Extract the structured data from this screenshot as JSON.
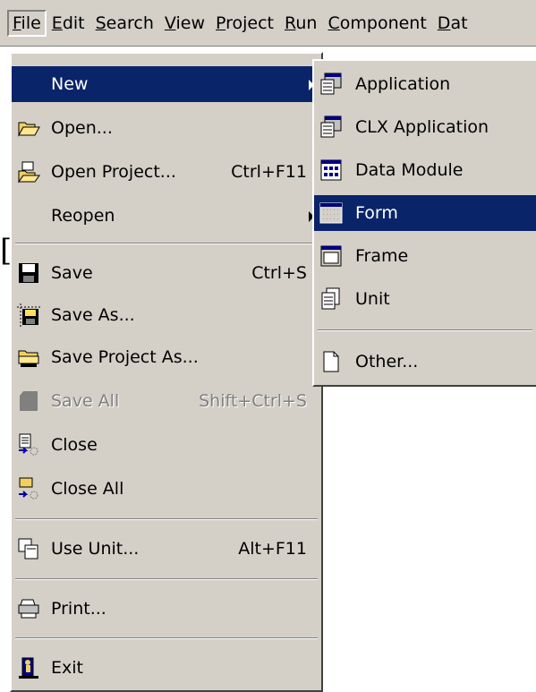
{
  "menubar": {
    "items": [
      {
        "label": "File",
        "accel": "F",
        "rest": "ile"
      },
      {
        "label": "Edit",
        "accel": "E",
        "rest": "dit"
      },
      {
        "label": "Search",
        "accel": "S",
        "rest": "earch"
      },
      {
        "label": "View",
        "accel": "V",
        "rest": "iew"
      },
      {
        "label": "Project",
        "accel": "P",
        "rest": "roject"
      },
      {
        "label": "Run",
        "accel": "R",
        "rest": "un"
      },
      {
        "label": "Component",
        "accel": "C",
        "rest": "omponent"
      },
      {
        "label": "Dat",
        "accel": "D",
        "rest": "at"
      }
    ]
  },
  "file_menu": {
    "items": [
      {
        "label": "New",
        "shortcut": "",
        "icon": "none",
        "submenu": true,
        "selected": true
      },
      {
        "label": "Open...",
        "shortcut": "",
        "icon": "open-folder-icon"
      },
      {
        "label": "Open Project...",
        "shortcut": "Ctrl+F11",
        "icon": "open-project-icon"
      },
      {
        "label": "Reopen",
        "shortcut": "",
        "icon": "none",
        "submenu": true
      },
      {
        "label": "Save",
        "shortcut": "Ctrl+S",
        "icon": "floppy-icon"
      },
      {
        "label": "Save As...",
        "shortcut": "",
        "icon": "save-as-icon"
      },
      {
        "label": "Save Project As...",
        "shortcut": "",
        "icon": "save-project-icon"
      },
      {
        "label": "Save All",
        "shortcut": "Shift+Ctrl+S",
        "icon": "save-all-icon",
        "disabled": true
      },
      {
        "label": "Close",
        "shortcut": "",
        "icon": "close-file-icon"
      },
      {
        "label": "Close All",
        "shortcut": "",
        "icon": "close-all-icon"
      },
      {
        "label": "Use Unit...",
        "shortcut": "Alt+F11",
        "icon": "use-unit-icon"
      },
      {
        "label": "Print...",
        "shortcut": "",
        "icon": "printer-icon"
      },
      {
        "label": "Exit",
        "shortcut": "",
        "icon": "exit-door-icon"
      }
    ]
  },
  "new_menu": {
    "items": [
      {
        "label": "Application",
        "icon": "application-icon"
      },
      {
        "label": "CLX Application",
        "icon": "clx-application-icon"
      },
      {
        "label": "Data Module",
        "icon": "data-module-icon"
      },
      {
        "label": "Form",
        "icon": "form-icon",
        "selected": true
      },
      {
        "label": "Frame",
        "icon": "frame-icon"
      },
      {
        "label": "Unit",
        "icon": "unit-icon"
      },
      {
        "label": "Other...",
        "icon": "other-icon"
      }
    ]
  },
  "colors": {
    "menu_bg": "#d4d0c8",
    "highlight": "#0a246a",
    "disabled": "#808080"
  }
}
